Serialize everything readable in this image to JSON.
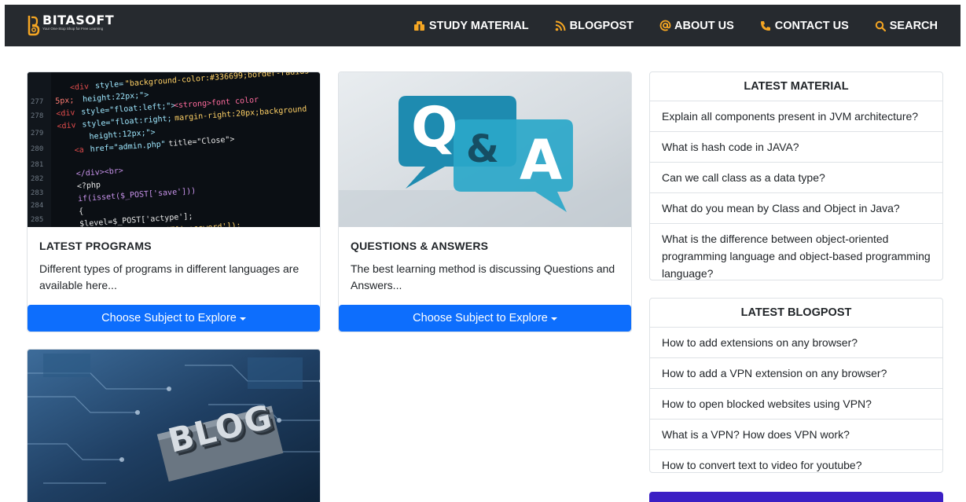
{
  "brand": {
    "name": "BITASOFT",
    "tagline": "Your One-Stop Shop for Free Learning",
    "accent": "#f5a623"
  },
  "nav": [
    {
      "label": "STUDY MATERIAL",
      "icon": "box-icon"
    },
    {
      "label": "BLOGPOST",
      "icon": "rss-icon"
    },
    {
      "label": "ABOUT US",
      "icon": "at-icon"
    },
    {
      "label": "CONTACT US",
      "icon": "phone-icon"
    },
    {
      "label": "SEARCH",
      "icon": "search-icon"
    }
  ],
  "cards": [
    {
      "title": "LATEST PROGRAMS",
      "text": "Different types of programs in different languages are available here...",
      "button": "Choose Subject to Explore",
      "image": "code-screen-image"
    },
    {
      "title": "QUESTIONS & ANSWERS",
      "text": "The best learning method is discussing Questions and Answers...",
      "button": "Choose Subject to Explore",
      "image": "qa-bubbles-image",
      "image_text": {
        "q": "Q",
        "amp": "&",
        "a": "A"
      }
    },
    {
      "image": "blog-circuit-image",
      "image_text": "BLOG"
    }
  ],
  "latest_material": {
    "heading": "LATEST MATERIAL",
    "items": [
      "Explain all components present in JVM architecture?",
      "What is hash code in JAVA?",
      "Can we call class as a data type?",
      "What do you mean by Class and Object in Java?",
      "What is the difference between object-oriented programming language and object-based programming language?"
    ]
  },
  "latest_blogpost": {
    "heading": "LATEST BLOGPOST",
    "items": [
      "How to add extensions on any browser?",
      "How to add a VPN extension on any browser?",
      "How to open blocked websites using VPN?",
      "What is a VPN? How does VPN work?",
      "How to convert text to video for youtube?"
    ]
  },
  "colors": {
    "navbar": "#262a2f",
    "nav_icon": "#f5a623",
    "primary_button": "#0d6efd",
    "border": "#dee2e6"
  }
}
